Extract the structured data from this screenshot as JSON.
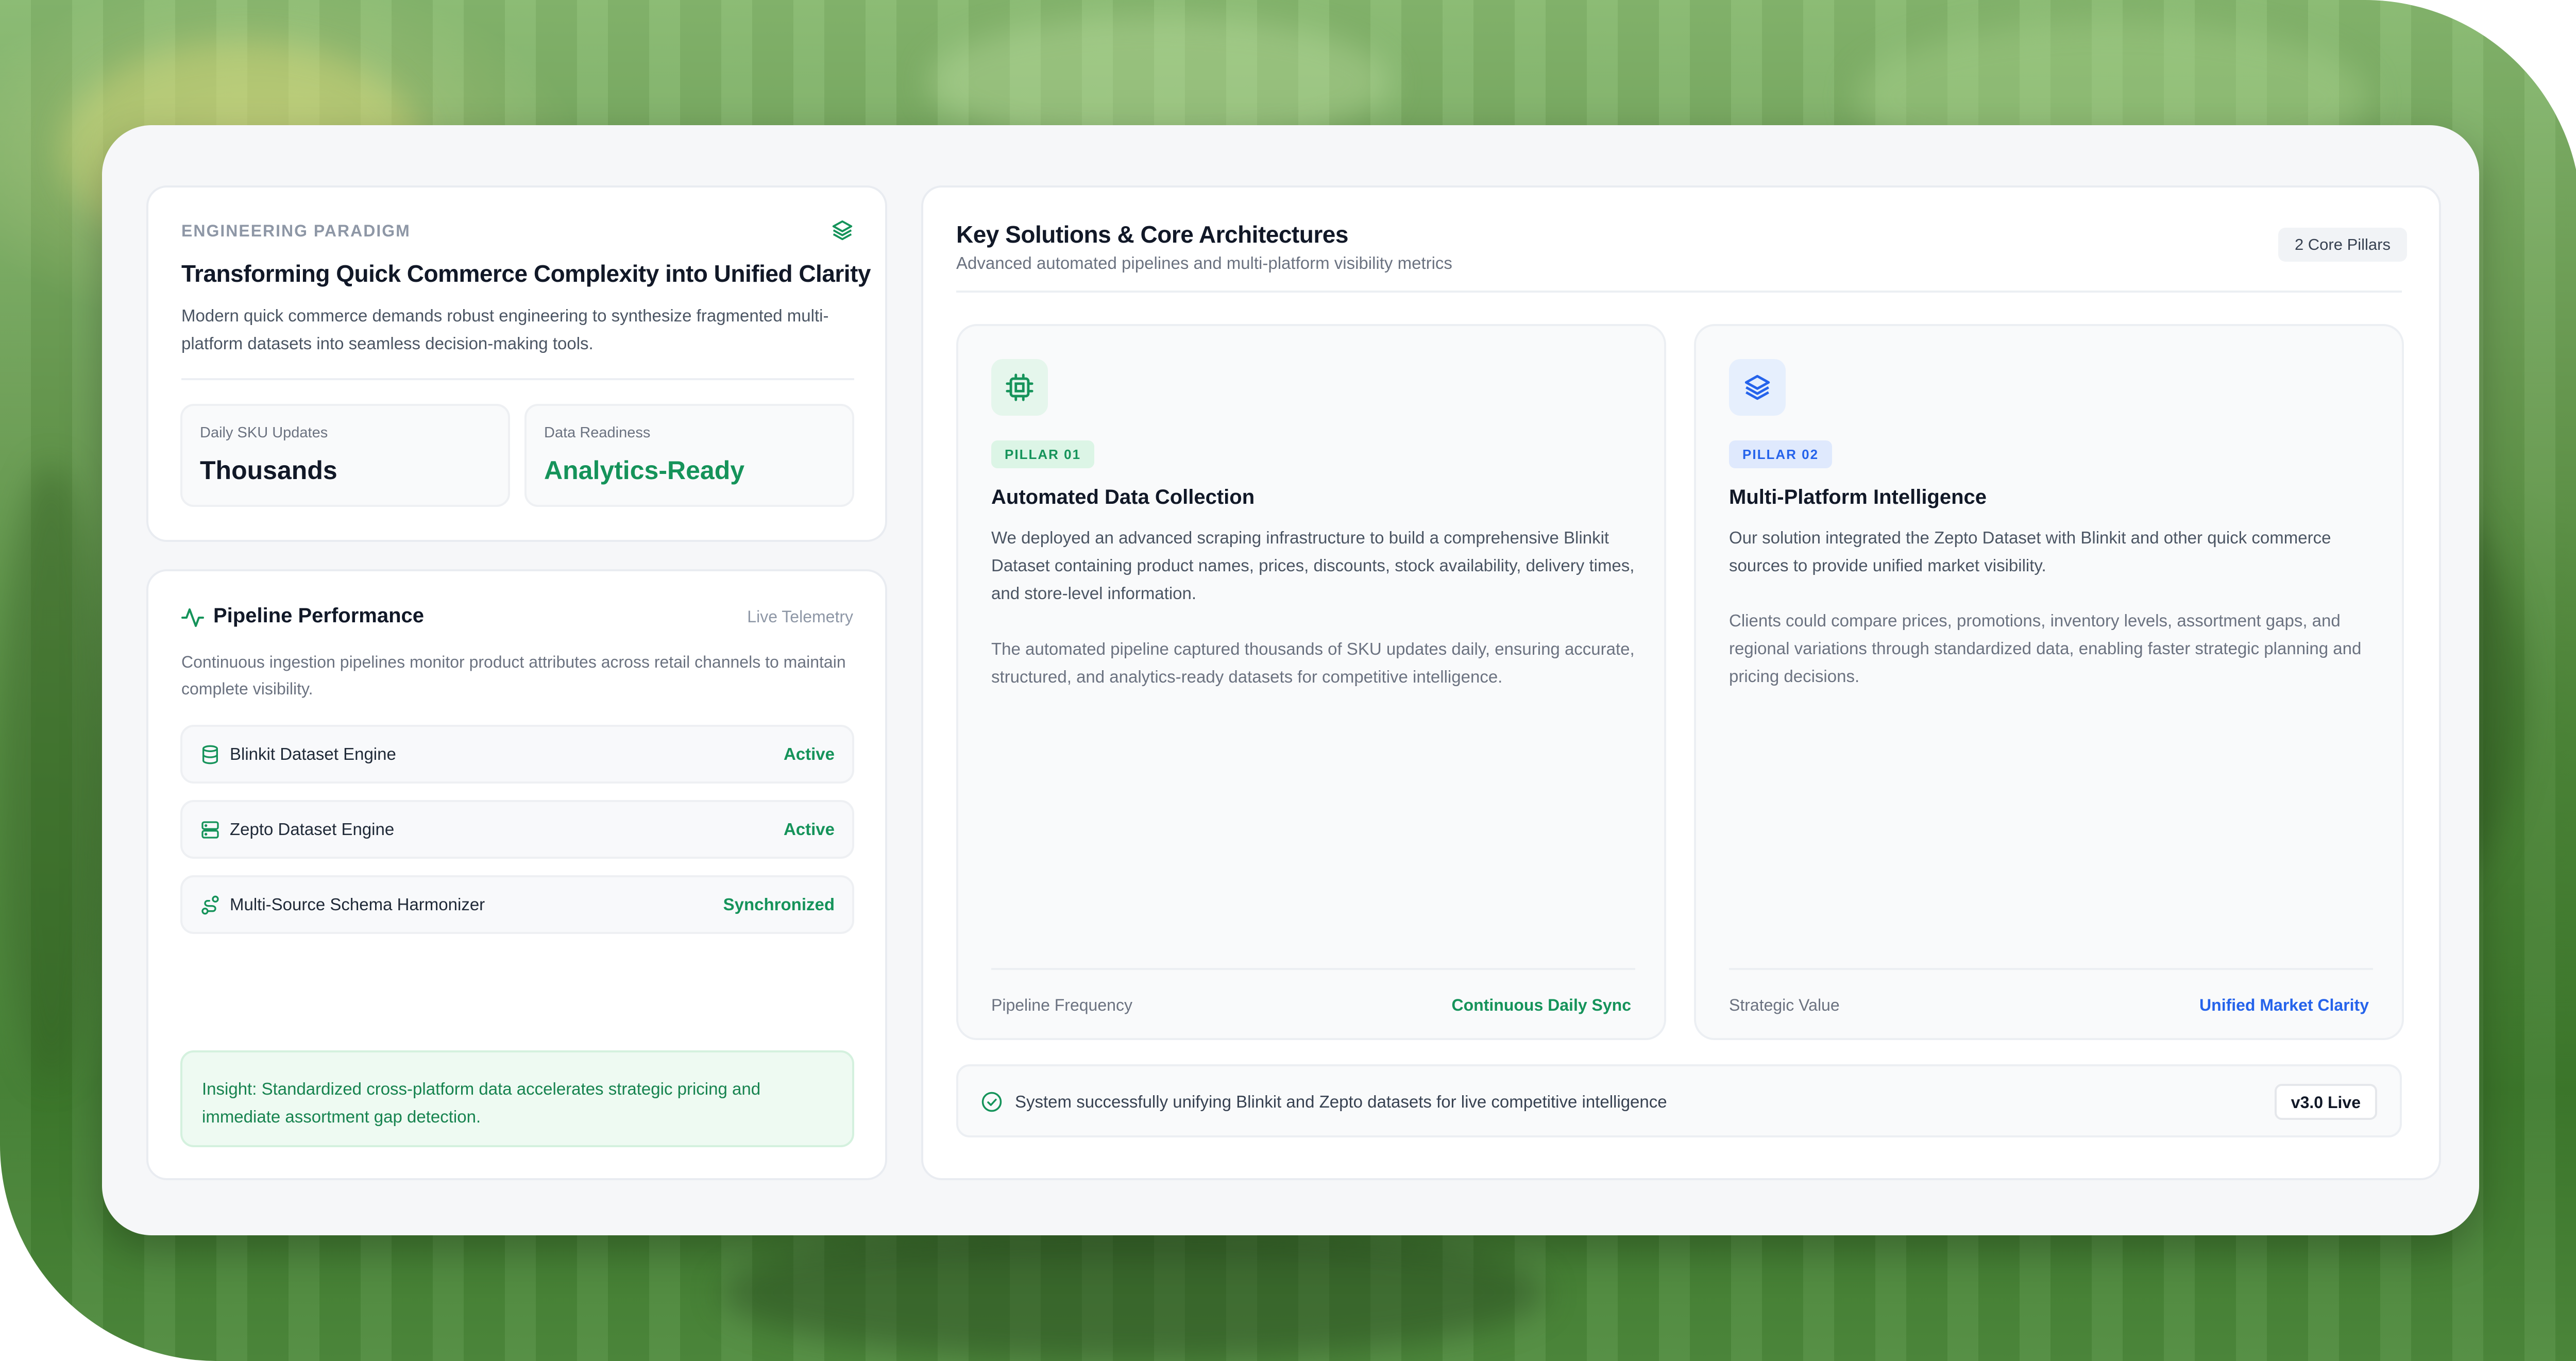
{
  "paradigm": {
    "eyebrow": "ENGINEERING PARADIGM",
    "icon": "stack-icon",
    "title": "Transforming Quick Commerce Complexity into Unified Clarity",
    "description": "Modern quick commerce demands robust engineering to synthesize fragmented multi-platform datasets into seamless decision-making tools.",
    "stats": [
      {
        "label": "Daily SKU Updates",
        "value": "Thousands"
      },
      {
        "label": "Data Readiness",
        "value": "Analytics-Ready"
      }
    ]
  },
  "pipeline": {
    "icon": "activity-icon",
    "title": "Pipeline Performance",
    "live_label": "Live Telemetry",
    "description": "Continuous ingestion pipelines monitor product attributes across retail channels to maintain complete visibility.",
    "engines": [
      {
        "icon": "database-icon",
        "name": "Blinkit Dataset Engine",
        "status": "Active"
      },
      {
        "icon": "server-icon",
        "name": "Zepto Dataset Engine",
        "status": "Active"
      },
      {
        "icon": "route-icon",
        "name": "Multi-Source Schema Harmonizer",
        "status": "Synchronized"
      }
    ],
    "insight": "Insight: Standardized cross-platform data accelerates strategic pricing and immediate assortment gap detection."
  },
  "solutions": {
    "title": "Key Solutions & Core Architectures",
    "subtitle": "Advanced automated pipelines and multi-platform visibility metrics",
    "badge": "2 Core Pillars",
    "pillars": [
      {
        "icon": "cpu-icon",
        "tag": "PILLAR 01",
        "title": "Automated Data Collection",
        "desc1": "We deployed an advanced scraping infrastructure to build a comprehensive Blinkit Dataset containing product names, prices, discounts, stock availability, delivery times, and store-level information.",
        "desc2": "The automated pipeline captured thousands of SKU updates daily, ensuring accurate, structured, and analytics-ready datasets for competitive intelligence.",
        "footer_label": "Pipeline Frequency",
        "footer_value": "Continuous Daily Sync"
      },
      {
        "icon": "layers-icon",
        "tag": "PILLAR 02",
        "title": "Multi-Platform Intelligence",
        "desc1": "Our solution integrated the Zepto Dataset with Blinkit and other quick commerce sources to provide unified market visibility.",
        "desc2": "Clients could compare prices, promotions, inventory levels, assortment gaps, and regional variations through standardized data, enabling faster strategic planning and pricing decisions.",
        "footer_label": "Strategic Value",
        "footer_value": "Unified Market Clarity"
      }
    ],
    "status": {
      "icon": "check-circle-icon",
      "text": "System successfully unifying Blinkit and Zepto datasets for live competitive intelligence",
      "version": "v3.0 Live"
    }
  },
  "colors": {
    "accent_green": "#15935a",
    "accent_blue": "#2563eb",
    "background_green": "#5a9447"
  }
}
